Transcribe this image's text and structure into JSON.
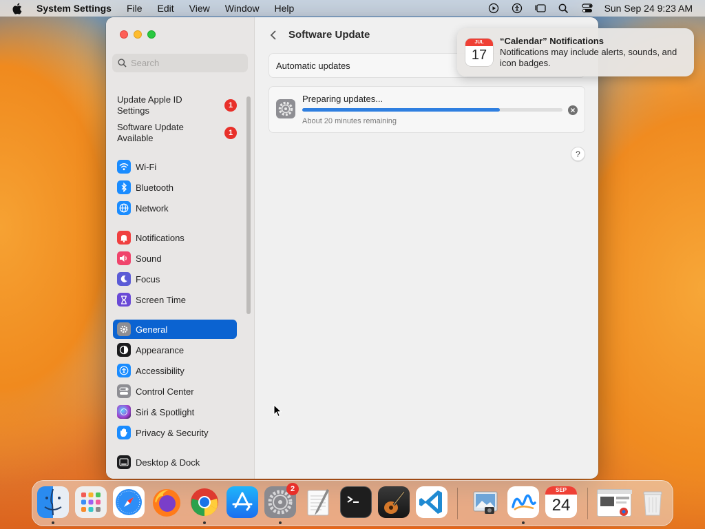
{
  "menubar": {
    "app_name": "System Settings",
    "menus": [
      "File",
      "Edit",
      "View",
      "Window",
      "Help"
    ],
    "clock": "Sun Sep 24  9:23 AM"
  },
  "search": {
    "placeholder": "Search"
  },
  "sidebar": {
    "notices": [
      {
        "label": "Update Apple ID Settings",
        "badge": "1"
      },
      {
        "label": "Software Update Available",
        "badge": "1"
      }
    ],
    "items": [
      {
        "label": "Wi-Fi",
        "icon": "wifi-icon",
        "color": "#1a8cff"
      },
      {
        "label": "Bluetooth",
        "icon": "bluetooth-icon",
        "color": "#1a8cff"
      },
      {
        "label": "Network",
        "icon": "globe-icon",
        "color": "#1a8cff"
      },
      {
        "label": "Notifications",
        "icon": "bell-icon",
        "color": "#f04040"
      },
      {
        "label": "Sound",
        "icon": "speaker-icon",
        "color": "#f0446c"
      },
      {
        "label": "Focus",
        "icon": "moon-icon",
        "color": "#5b5bd6"
      },
      {
        "label": "Screen Time",
        "icon": "hourglass-icon",
        "color": "#6a4ad6"
      },
      {
        "label": "General",
        "icon": "gear-icon",
        "color": "#8e8e93",
        "selected": true
      },
      {
        "label": "Appearance",
        "icon": "appearance-icon",
        "color": "#1c1c1e"
      },
      {
        "label": "Accessibility",
        "icon": "accessibility-icon",
        "color": "#1a8cff"
      },
      {
        "label": "Control Center",
        "icon": "toggles-icon",
        "color": "#8e8e93"
      },
      {
        "label": "Siri & Spotlight",
        "icon": "siri-icon",
        "color": "#c040c0"
      },
      {
        "label": "Privacy & Security",
        "icon": "hand-icon",
        "color": "#1a8cff"
      },
      {
        "label": "Desktop & Dock",
        "icon": "dock-icon",
        "color": "#1c1c1e"
      }
    ]
  },
  "content": {
    "title": "Software Update",
    "automatic_updates": "Automatic updates",
    "update": {
      "title": "Preparing updates...",
      "progress": 0.76,
      "remaining": "About 20 minutes remaining"
    },
    "help": "?"
  },
  "notification": {
    "month": "JUL",
    "day": "17",
    "title": "“Calendar” Notifications",
    "body": "Notifications may include alerts, sounds, and icon badges."
  },
  "dock": {
    "settings_badge": "2",
    "calendar_month": "SEP",
    "calendar_day": "24"
  }
}
